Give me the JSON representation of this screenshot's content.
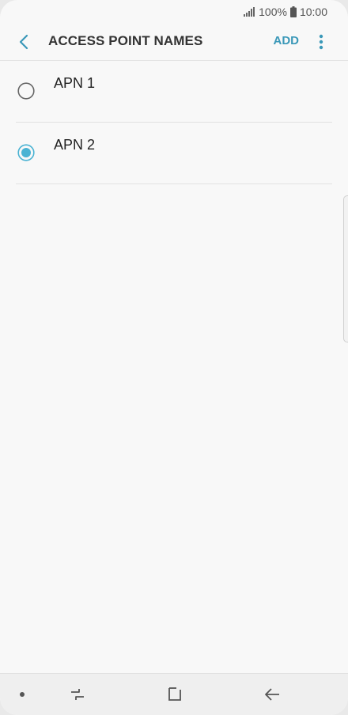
{
  "status_bar": {
    "battery": "100%",
    "time": "10:00",
    "icons": [
      "signal-icon",
      "battery-icon"
    ]
  },
  "header": {
    "title": "ACCESS POINT NAMES",
    "add_label": "ADD",
    "icons": [
      "back-arrow-icon",
      "more-vert-icon"
    ]
  },
  "apn_list": {
    "items": [
      {
        "label": "APN 1",
        "selected": false
      },
      {
        "label": "APN 2",
        "selected": true
      }
    ]
  },
  "nav_bar": {
    "icons": [
      "recent-apps-icon",
      "home-icon",
      "back-icon"
    ]
  },
  "colors": {
    "accent": "#3a98b8",
    "radio_selected": "#4ab3d3",
    "radio_unselected": "#666666",
    "background": "#f8f8f8"
  }
}
